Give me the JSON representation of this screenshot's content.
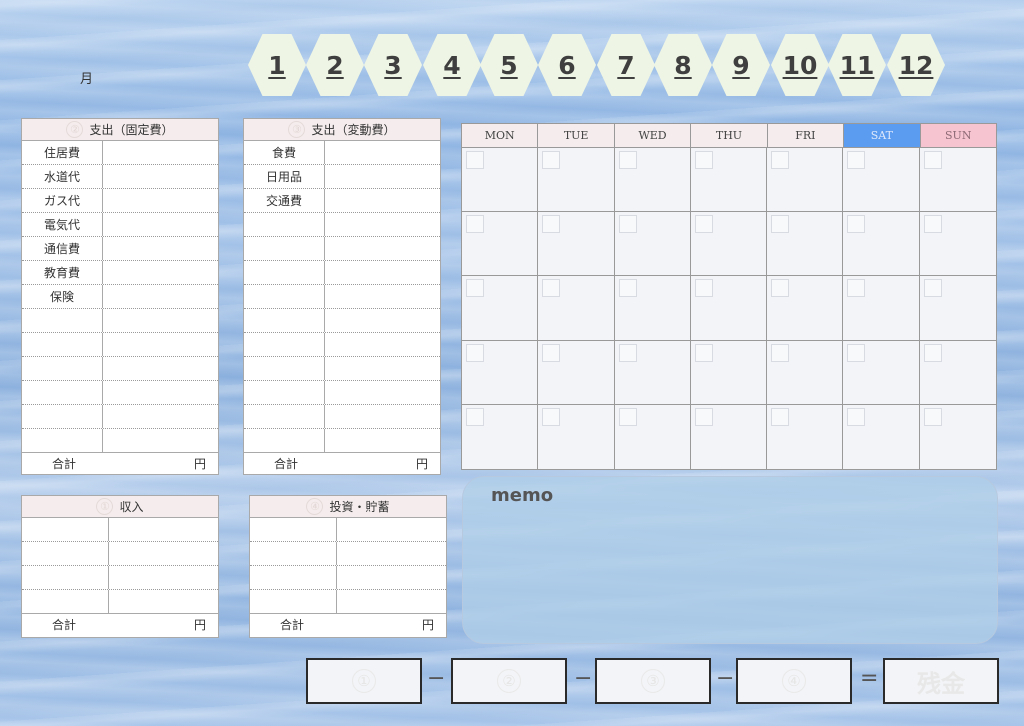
{
  "header": {
    "month_label": "月",
    "months": [
      "1",
      "2",
      "3",
      "4",
      "5",
      "6",
      "7",
      "8",
      "9",
      "10",
      "11",
      "12"
    ]
  },
  "fixed_expenses": {
    "number": "②",
    "title": "支出（固定費）",
    "items": [
      "住居費",
      "水道代",
      "ガス代",
      "電気代",
      "通信費",
      "教育費",
      "保険",
      "",
      "",
      "",
      "",
      "",
      ""
    ],
    "total_label": "合計",
    "unit": "円"
  },
  "variable_expenses": {
    "number": "③",
    "title": "支出（変動費）",
    "items": [
      "食費",
      "日用品",
      "交通費",
      "",
      "",
      "",
      "",
      "",
      "",
      "",
      "",
      "",
      ""
    ],
    "total_label": "合計",
    "unit": "円"
  },
  "income": {
    "number": "①",
    "title": "収入",
    "rows": [
      "",
      "",
      "",
      ""
    ],
    "total_label": "合計",
    "unit": "円"
  },
  "savings": {
    "number": "④",
    "title": "投資・貯蓄",
    "rows": [
      "",
      "",
      "",
      ""
    ],
    "total_label": "合計",
    "unit": "円"
  },
  "calendar": {
    "days": [
      "MON",
      "TUE",
      "WED",
      "THU",
      "FRI",
      "SAT",
      "SUN"
    ],
    "weeks": 5
  },
  "memo": {
    "title": "memo"
  },
  "summary": {
    "boxes": [
      "①",
      "②",
      "③",
      "④"
    ],
    "operators": [
      "−",
      "−",
      "−",
      "="
    ],
    "result_label": "残金"
  }
}
